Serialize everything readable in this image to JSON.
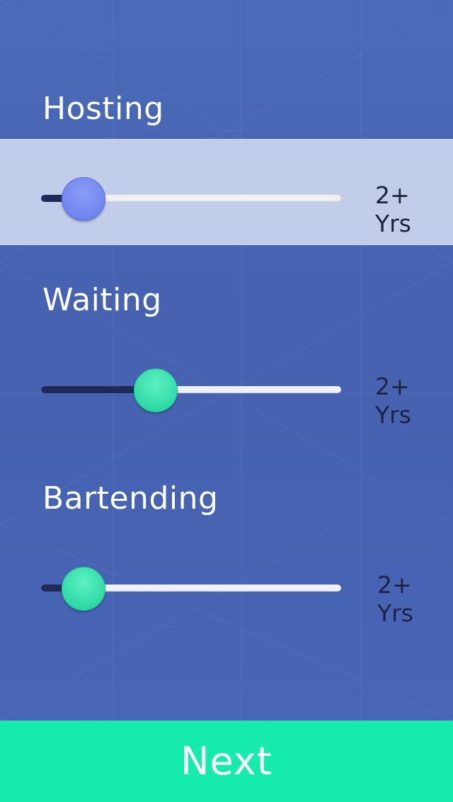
{
  "colors": {
    "background": "#4a66b4",
    "highlight": "#dfe5f5",
    "track": "#f0f1f4",
    "track_fill": "#1f2a57",
    "thumb_active": "#6f86ef",
    "thumb_default": "#2fdaa6",
    "next_button": "#15ecac"
  },
  "skills": [
    {
      "title": "Hosting",
      "value_label": "2+ Yrs",
      "slider_value_pct": 14,
      "selected": true
    },
    {
      "title": "Waiting",
      "value_label": "2+ Yrs",
      "slider_value_pct": 38,
      "selected": false
    },
    {
      "title": "Bartending",
      "value_label": "2+ Yrs",
      "slider_value_pct": 14,
      "selected": false
    }
  ],
  "next_button": {
    "label": "Next"
  }
}
